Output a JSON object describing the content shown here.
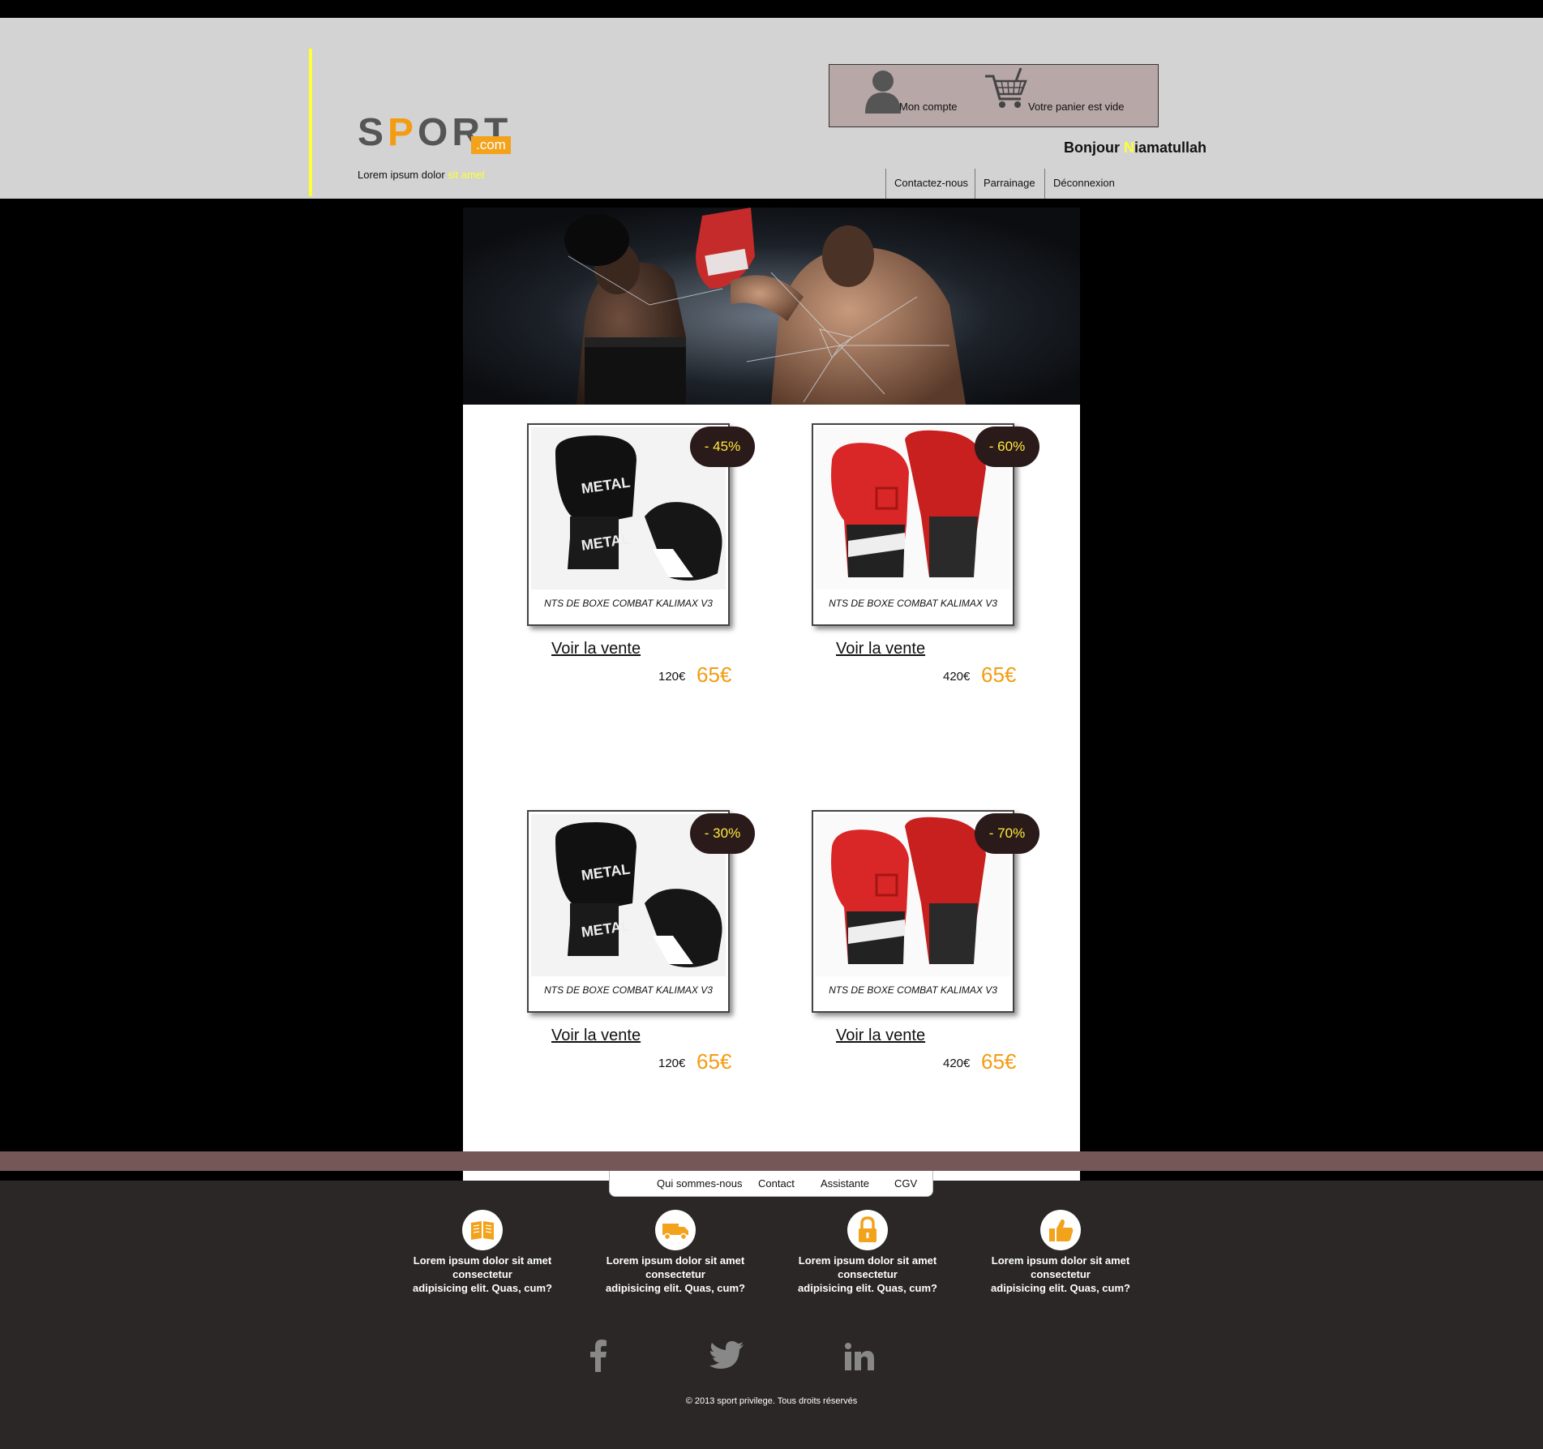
{
  "header": {
    "logo_main": "SPORT",
    "logo_suffix": ".com",
    "tagline_plain": "Lorem ipsum dolor ",
    "tagline_highlight": "sit amet",
    "account_label": "Mon compte",
    "cart_label": "Votre panier est vide",
    "greeting_word": "Bonjour ",
    "greeting_initial": "N",
    "greeting_rest": "iamatullah",
    "nav": [
      "Contactez-nous",
      "Parrainage",
      "Déconnexion"
    ]
  },
  "products": [
    {
      "caption": "NTS DE BOXE COMBAT KALIMAX V3",
      "discount": "- 45%",
      "link": "Voir la vente",
      "old_price": "120€",
      "new_price": "65€",
      "glove": "black"
    },
    {
      "caption": "NTS DE BOXE COMBAT KALIMAX V3",
      "discount": "- 60%",
      "link": "Voir la vente",
      "old_price": "420€",
      "new_price": "65€",
      "glove": "red"
    },
    {
      "caption": "NTS DE BOXE COMBAT KALIMAX V3",
      "discount": "- 30%",
      "link": "Voir la vente",
      "old_price": "120€",
      "new_price": "65€",
      "glove": "black"
    },
    {
      "caption": "NTS DE BOXE COMBAT KALIMAX V3",
      "discount": "- 70%",
      "link": "Voir la vente",
      "old_price": "420€",
      "new_price": "65€",
      "glove": "red"
    }
  ],
  "footer": {
    "nav": [
      "Qui sommes-nous",
      "Contact",
      "Assistante",
      "CGV"
    ],
    "features": [
      {
        "icon": "book-icon",
        "text_line1": "Lorem ipsum dolor sit amet consectetur",
        "text_line2": "adipisicing elit. Quas, cum?"
      },
      {
        "icon": "truck-icon",
        "text_line1": "Lorem ipsum dolor sit amet consectetur",
        "text_line2": "adipisicing elit. Quas, cum?"
      },
      {
        "icon": "lock-icon",
        "text_line1": "Lorem ipsum dolor sit amet consectetur",
        "text_line2": "adipisicing elit. Quas, cum?"
      },
      {
        "icon": "thumbs-up-icon",
        "text_line1": "Lorem ipsum dolor sit amet consectetur",
        "text_line2": "adipisicing elit. Quas, cum?"
      }
    ],
    "social": [
      "facebook-icon",
      "twitter-icon",
      "linkedin-icon"
    ],
    "copyright": "© 2013 sport privilege. Tous droits réservés"
  },
  "colors": {
    "accent_orange": "#f39c12",
    "highlight_yellow": "#ffff33",
    "header_bg": "#d3d3d3",
    "account_box_bg": "#b7a7a7",
    "footer_band": "#765757",
    "footer_bg": "#2b2726",
    "badge_bg": "#2a1a1a"
  }
}
